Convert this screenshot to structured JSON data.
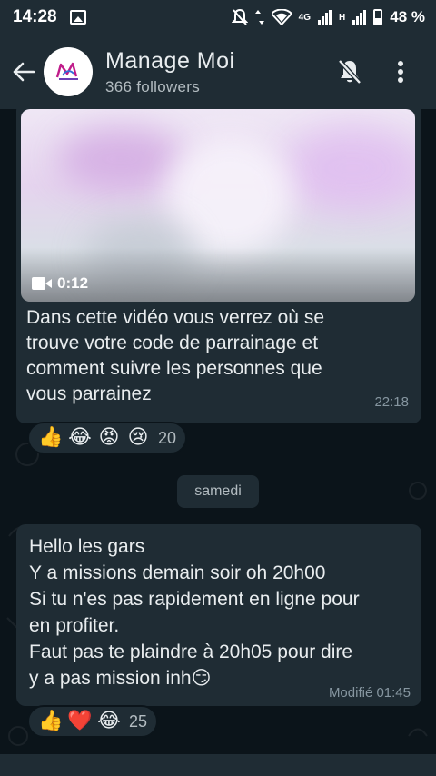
{
  "status_bar": {
    "time": "14:28",
    "network": "4G",
    "network_mark": "H",
    "battery": "48 %"
  },
  "header": {
    "title": "Manage Moi",
    "subtitle": "366 followers",
    "icons": [
      "back-arrow-icon",
      "mute-bell-icon",
      "more-vert-icon"
    ]
  },
  "messages": [
    {
      "type": "video",
      "duration": "0:12",
      "text": "Dans cette vidéo vous verrez où se\ntrouve votre code de parrainage et\ncomment suivre les personnes que\nvous parrainez",
      "time": "22:18",
      "reactions": {
        "emojis": [
          "👍",
          "😂",
          "😡",
          "😢"
        ],
        "count": "20"
      }
    },
    {
      "type": "text",
      "text": "Hello les gars\nY a missions demain soir oh 20h00\nSi tu n'es pas rapidement en ligne pour\nen profiter.\nFaut pas te plaindre à 20h05 pour dire\ny a pas mission inh😏",
      "edited_time": "Modifié  01:45",
      "reactions": {
        "emojis": [
          "👍",
          "❤️",
          "😂"
        ],
        "count": "25"
      }
    }
  ],
  "date_separator": "samedi",
  "colors": {
    "background": "#0b141a",
    "bubble": "#1f2c34",
    "header": "#1f2c34",
    "text": "#e9edef",
    "muted": "#8696a0"
  }
}
